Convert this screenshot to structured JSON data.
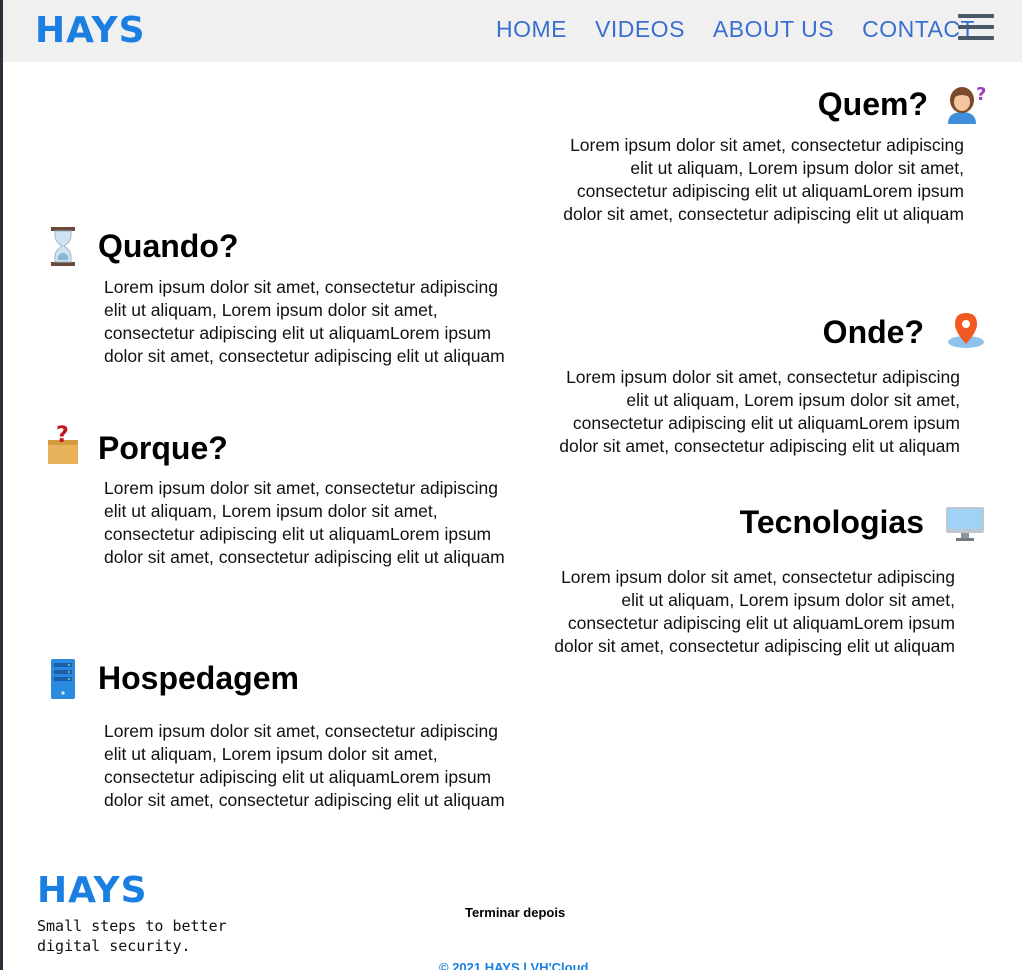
{
  "header": {
    "logo": "HAYS",
    "nav": [
      "HOME",
      "VIDEOS",
      "ABOUT US",
      "CONTACT"
    ]
  },
  "sections": {
    "quem": {
      "title": "Quem?",
      "icon": "woman-question-icon",
      "text": "Lorem ipsum dolor sit amet, consectetur adipiscing elit ut aliquam, Lorem ipsum dolor sit amet, consectetur adipiscing elit ut aliquamLorem ipsum dolor sit amet, consectetur adipiscing elit ut aliquam"
    },
    "quando": {
      "title": "Quando?",
      "icon": "hourglass-icon",
      "text": "Lorem ipsum dolor sit amet, consectetur adipiscing elit ut aliquam, Lorem ipsum dolor sit amet, consectetur adipiscing elit ut aliquamLorem ipsum dolor sit amet, consectetur adipiscing elit ut aliquam"
    },
    "onde": {
      "title": "Onde?",
      "icon": "map-pin-icon",
      "text": "Lorem ipsum dolor sit amet, consectetur adipiscing elit ut aliquam, Lorem ipsum dolor sit amet, consectetur adipiscing elit ut aliquamLorem ipsum dolor sit amet, consectetur adipiscing elit ut aliquam"
    },
    "porque": {
      "title": "Porque?",
      "icon": "question-box-icon",
      "text": "Lorem ipsum dolor sit amet, consectetur adipiscing elit ut aliquam, Lorem ipsum dolor sit amet, consectetur adipiscing elit ut aliquamLorem ipsum dolor sit amet, consectetur adipiscing elit ut aliquam"
    },
    "tecnologias": {
      "title": "Tecnologias",
      "icon": "monitor-icon",
      "text": "Lorem ipsum dolor sit amet, consectetur adipiscing elit ut aliquam, Lorem ipsum dolor sit amet, consectetur adipiscing elit ut aliquamLorem ipsum dolor sit amet, consectetur adipiscing elit ut aliquam"
    },
    "hospedagem": {
      "title": "Hospedagem",
      "icon": "server-icon",
      "text": "Lorem ipsum dolor sit amet, consectetur adipiscing elit ut aliquam, Lorem ipsum dolor sit amet, consectetur adipiscing elit ut aliquamLorem ipsum dolor sit amet, consectetur adipiscing elit ut aliquam"
    }
  },
  "footer": {
    "logo": "HAYS",
    "tagline": "Small steps to better digital security.",
    "note": "Terminar depois",
    "copyright": "© 2021 HAYS | VH'Cloud"
  },
  "colors": {
    "brand": "#1a7fe0",
    "nav_link": "#3a6fd0",
    "header_bg": "#f0f0f0"
  }
}
